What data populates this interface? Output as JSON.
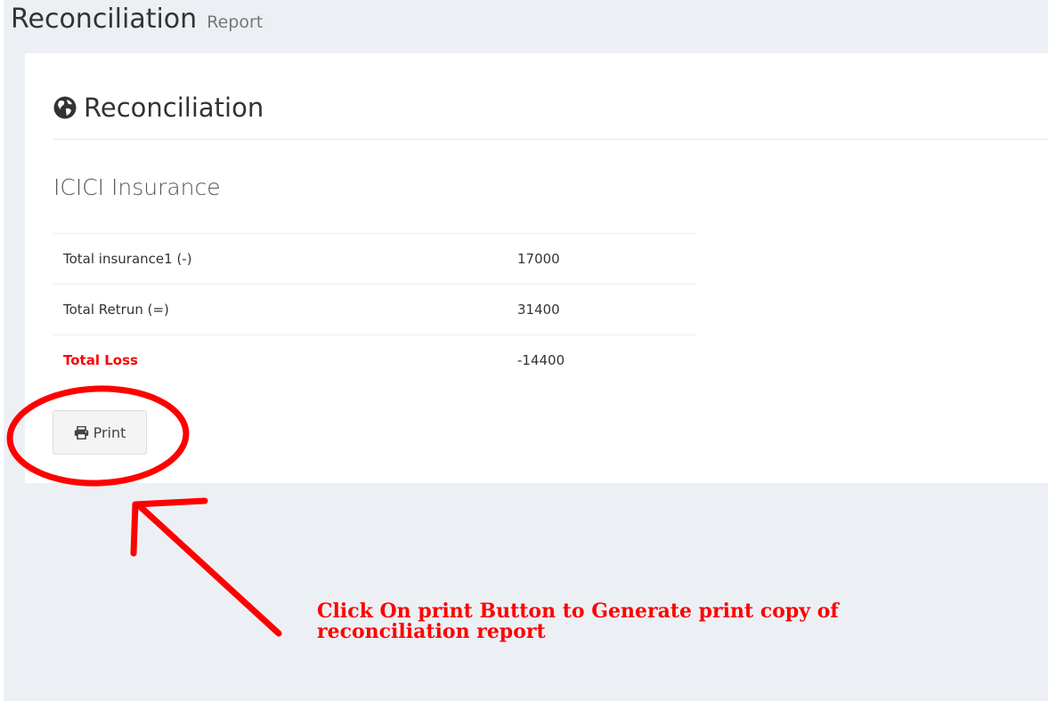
{
  "header": {
    "title": "Reconciliation",
    "subtitle": "Report"
  },
  "box": {
    "title": "Reconciliation",
    "title_icon": "globe-icon",
    "company": "ICICI Insurance"
  },
  "summary": {
    "rows": [
      {
        "label": "Total insurance1 (-)",
        "value": "17000"
      },
      {
        "label": "Total Retrun (=)",
        "value": "31400"
      },
      {
        "label": "Total Loss",
        "value": "-14400"
      }
    ]
  },
  "print_button": {
    "label": "Print",
    "icon": "print-icon"
  },
  "annotation": {
    "text": "Click On print Button to Generate print copy of reconciliation report",
    "color": "#ff0000"
  },
  "colors": {
    "page_background": "#ecf0f5",
    "box_background": "#ffffff",
    "loss_label": "#ff0000"
  }
}
